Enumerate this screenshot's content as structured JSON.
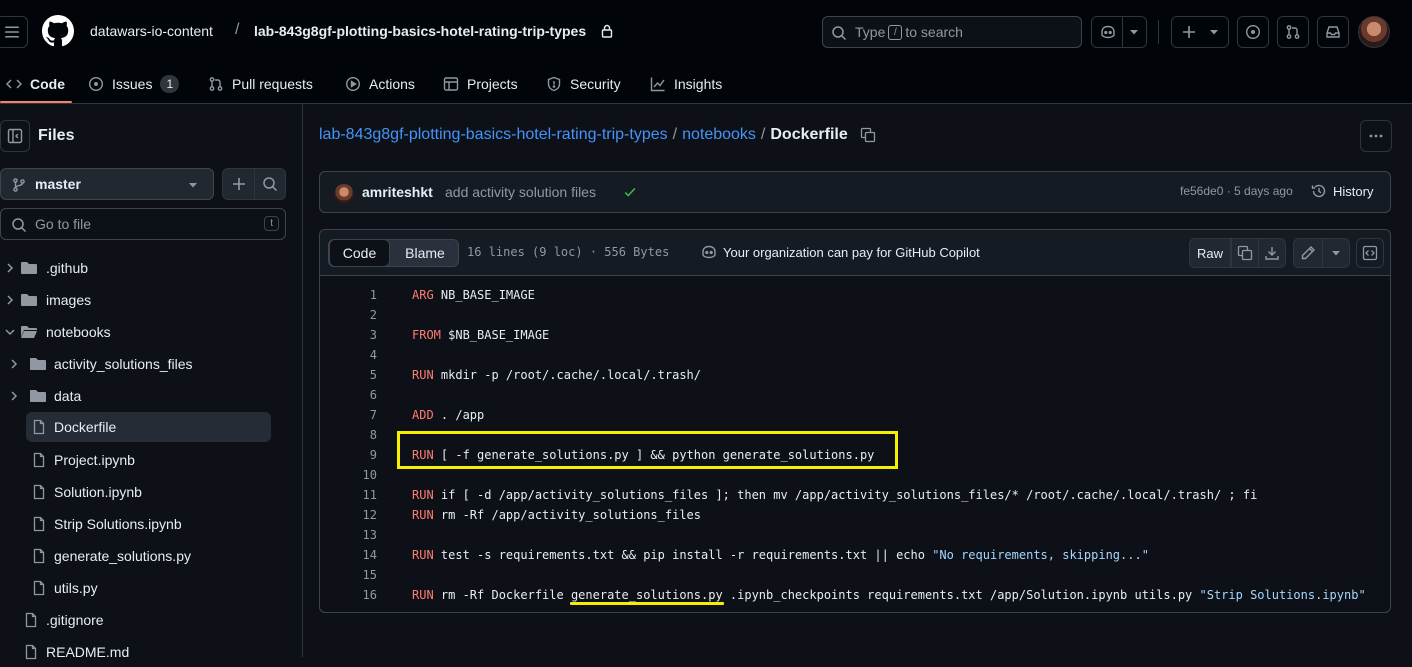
{
  "header": {
    "owner": "datawars-io-content",
    "separator": "/",
    "repo": "lab-843g8gf-plotting-basics-hotel-rating-trip-types",
    "search_prefix": "Type",
    "search_key": "/",
    "search_suffix": "to search"
  },
  "tabs": [
    {
      "label": "Code"
    },
    {
      "label": "Issues",
      "count": "1"
    },
    {
      "label": "Pull requests"
    },
    {
      "label": "Actions"
    },
    {
      "label": "Projects"
    },
    {
      "label": "Security"
    },
    {
      "label": "Insights"
    }
  ],
  "sidebar": {
    "title": "Files",
    "branch": "master",
    "goto_placeholder": "Go to file",
    "goto_key": "t",
    "tree": [
      {
        "name": ".github",
        "type": "folder"
      },
      {
        "name": "images",
        "type": "folder"
      },
      {
        "name": "notebooks",
        "type": "folder-open"
      },
      {
        "name": "activity_solutions_files",
        "type": "folder"
      },
      {
        "name": "data",
        "type": "folder"
      },
      {
        "name": "Dockerfile",
        "type": "file"
      },
      {
        "name": "Project.ipynb",
        "type": "file"
      },
      {
        "name": "Solution.ipynb",
        "type": "file"
      },
      {
        "name": "Strip Solutions.ipynb",
        "type": "file"
      },
      {
        "name": "generate_solutions.py",
        "type": "file"
      },
      {
        "name": "utils.py",
        "type": "file"
      },
      {
        "name": ".gitignore",
        "type": "file"
      },
      {
        "name": "README.md",
        "type": "file"
      }
    ]
  },
  "main": {
    "path_repo": "lab-843g8gf-plotting-basics-hotel-rating-trip-types",
    "path_folder": "notebooks",
    "path_file": "Dockerfile",
    "path_sep": "/",
    "commit": {
      "author": "amriteshkt",
      "message": "add activity solution files",
      "hash_time": "fe56de0 · 5 days ago",
      "history_label": "History"
    },
    "code_tab": "Code",
    "blame_tab": "Blame",
    "meta": "16 lines (9 loc) · 556 Bytes",
    "copilot_note": "Your organization can pay for GitHub Copilot",
    "raw_label": "Raw",
    "lines": [
      {
        "n": "1",
        "kw": "ARG",
        "rest": " NB_BASE_IMAGE"
      },
      {
        "n": "2",
        "kw": "",
        "rest": ""
      },
      {
        "n": "3",
        "kw": "FROM",
        "rest": " $NB_BASE_IMAGE"
      },
      {
        "n": "4",
        "kw": "",
        "rest": ""
      },
      {
        "n": "5",
        "kw": "RUN",
        "rest": " mkdir -p /root/.cache/.local/.trash/"
      },
      {
        "n": "6",
        "kw": "",
        "rest": ""
      },
      {
        "n": "7",
        "kw": "ADD",
        "rest": " . /app"
      },
      {
        "n": "8",
        "kw": "",
        "rest": ""
      },
      {
        "n": "9",
        "kw": "RUN",
        "rest": " [ -f generate_solutions.py ] && python generate_solutions.py"
      },
      {
        "n": "10",
        "kw": "",
        "rest": ""
      },
      {
        "n": "11",
        "kw": "RUN",
        "rest": " if [ -d /app/activity_solutions_files ]; then mv /app/activity_solutions_files/* /root/.cache/.local/.trash/ ; fi"
      },
      {
        "n": "12",
        "kw": "RUN",
        "rest": " rm -Rf /app/activity_solutions_files"
      },
      {
        "n": "13",
        "kw": "",
        "rest": ""
      },
      {
        "n": "14",
        "kw": "RUN",
        "rest": " test -s requirements.txt && pip install -r requirements.txt || echo ",
        "str": "\"No requirements, skipping...\""
      },
      {
        "n": "15",
        "kw": "",
        "rest": ""
      },
      {
        "n": "16",
        "kw": "RUN",
        "rest": " rm -Rf Dockerfile generate_solutions.py .ipynb_checkpoints requirements.txt /app/Solution.ipynb utils.py ",
        "str": "\"Strip Solutions.ipynb\""
      }
    ]
  }
}
